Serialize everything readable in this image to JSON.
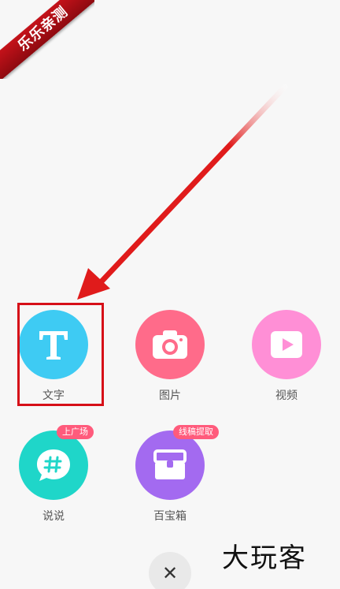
{
  "ribbon": {
    "text": "乐乐亲测"
  },
  "colors": {
    "text_circle": "#3ecbf3",
    "image_circle": "#ff6b8a",
    "video_circle": "#ff8fd6",
    "talk_circle": "#1fd6c9",
    "box_circle": "#a36af0",
    "badge": "#ff5b7c",
    "highlight": "#d60f18",
    "arrow": "#e01b1b"
  },
  "items": [
    {
      "id": "text",
      "label": "文字",
      "icon": "text-T-icon"
    },
    {
      "id": "image",
      "label": "图片",
      "icon": "camera-icon"
    },
    {
      "id": "video",
      "label": "视频",
      "icon": "play-icon"
    },
    {
      "id": "talk",
      "label": "说说",
      "icon": "hashtag-chat-icon",
      "badge": "上广场"
    },
    {
      "id": "box",
      "label": "百宝箱",
      "icon": "treasure-box-icon",
      "badge": "线稿提取"
    }
  ],
  "close_button": {
    "symbol": "✕",
    "icon": "close-icon"
  },
  "watermark": {
    "text": "大玩客"
  }
}
